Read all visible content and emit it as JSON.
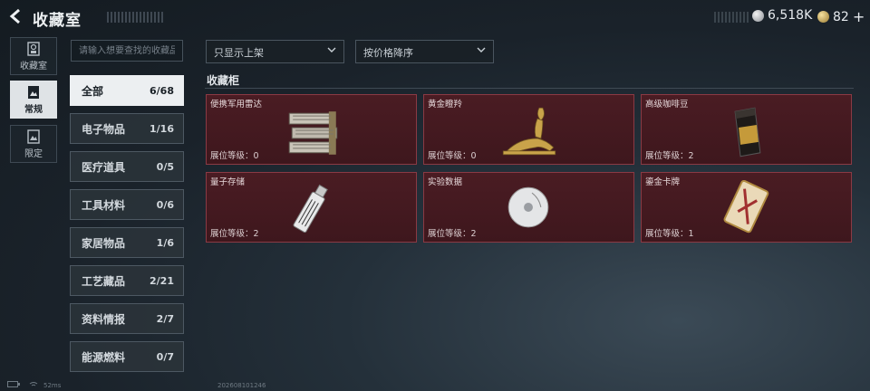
{
  "header": {
    "title": "收藏室",
    "silver_amount": "6,518K",
    "gold_amount": "82",
    "plus": "+"
  },
  "rail": [
    {
      "label": "收藏室"
    },
    {
      "label": "常规"
    },
    {
      "label": "限定"
    }
  ],
  "search": {
    "placeholder": "请输入想要查找的收藏品"
  },
  "filters": {
    "shelf_filter": "只显示上架",
    "sort": "按价格降序"
  },
  "categories": [
    {
      "label": "全部",
      "count": "6/68"
    },
    {
      "label": "电子物品",
      "count": "1/16"
    },
    {
      "label": "医疗道具",
      "count": "0/5"
    },
    {
      "label": "工具材料",
      "count": "0/6"
    },
    {
      "label": "家居物品",
      "count": "1/6"
    },
    {
      "label": "工艺藏品",
      "count": "2/21"
    },
    {
      "label": "资料情报",
      "count": "2/7"
    },
    {
      "label": "能源燃料",
      "count": "0/7"
    }
  ],
  "cabinet": {
    "title": "收藏柜",
    "items": [
      {
        "name": "便携军用雷达",
        "level": "展位等级：0",
        "art": "radar-icon"
      },
      {
        "name": "黄金瞪羚",
        "level": "展位等级：0",
        "art": "gazelle-icon"
      },
      {
        "name": "高级咖啡豆",
        "level": "展位等级：2",
        "art": "coffee-bag-icon"
      },
      {
        "name": "量子存储",
        "level": "展位等级：2",
        "art": "usb-drive-icon"
      },
      {
        "name": "实验数据",
        "level": "展位等级：2",
        "art": "disc-icon"
      },
      {
        "name": "鎏金卡牌",
        "level": "展位等级：1",
        "art": "card-icon"
      }
    ]
  },
  "status_bar": {
    "ping": "52ms",
    "code": "202608101246"
  },
  "colors": {
    "card_bg": "#4a1c23",
    "card_border": "#8a3a44",
    "active_bg": "#eceff1"
  }
}
